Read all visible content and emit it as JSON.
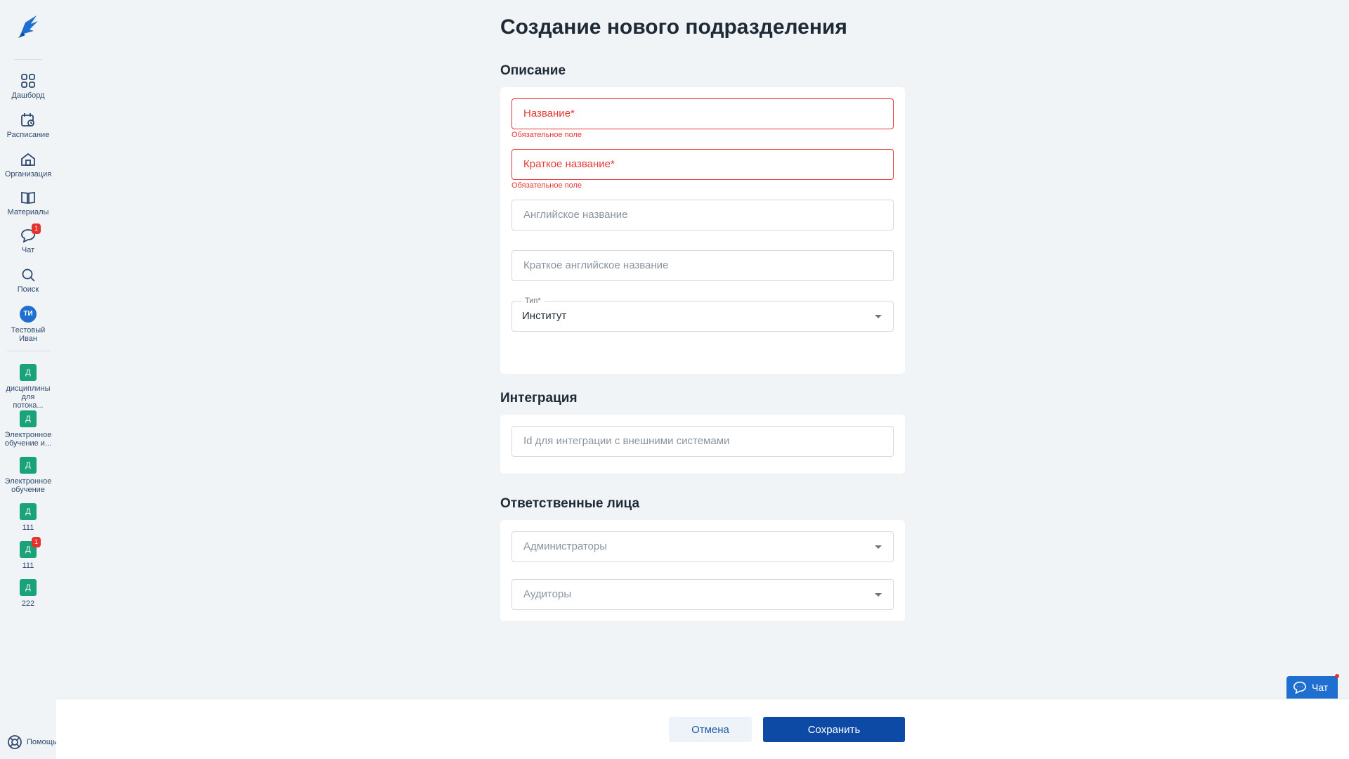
{
  "sidebar": {
    "items": [
      {
        "label": "Дашборд"
      },
      {
        "label": "Расписание"
      },
      {
        "label": "Организация"
      },
      {
        "label": "Материалы"
      },
      {
        "label": "Чат",
        "badge": "1"
      },
      {
        "label": "Поиск"
      },
      {
        "label": "Тестовый Иван",
        "avatar": "ТИ"
      }
    ],
    "spaces": [
      {
        "letter": "Д",
        "label": "дисциплины для потока..."
      },
      {
        "letter": "Д",
        "label": "Электронное обучение и..."
      },
      {
        "letter": "Д",
        "label": "Электронное обучение"
      },
      {
        "letter": "Д",
        "label": "111"
      },
      {
        "letter": "Д",
        "label": "111",
        "badge": "1"
      },
      {
        "letter": "Д",
        "label": "222"
      }
    ],
    "help_label": "Помощь"
  },
  "page": {
    "title": "Создание нового подразделения"
  },
  "description": {
    "title": "Описание",
    "name_placeholder": "Название*",
    "name_error": "Обязательное поле",
    "short_name_placeholder": "Краткое название*",
    "short_name_error": "Обязательное поле",
    "english_name_placeholder": "Английское название",
    "short_english_name_placeholder": "Краткое английское название",
    "type_label": "Тип*",
    "type_value": "Институт"
  },
  "integration": {
    "title": "Интеграция",
    "id_placeholder": "Id для интеграции с внешними системами"
  },
  "responsible": {
    "title": "Ответственные лица",
    "admins_placeholder": "Администраторы",
    "auditors_placeholder": "Аудиторы"
  },
  "footer": {
    "cancel_label": "Отмена",
    "save_label": "Сохранить"
  },
  "chat_widget": {
    "label": "Чат"
  },
  "colors": {
    "accent": "#0d4aa6",
    "error": "#e53935",
    "space_green": "#1aa37a",
    "badge_red": "#e5322d"
  }
}
